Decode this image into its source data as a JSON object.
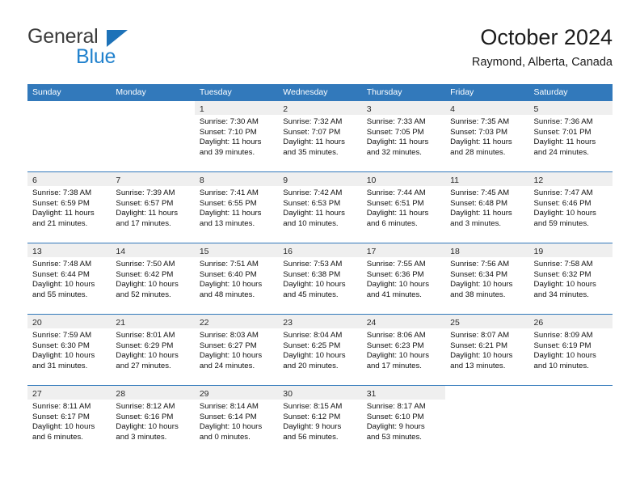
{
  "brand": {
    "name_top": "General",
    "name_bottom": "Blue",
    "triangle_color": "#1d72b8",
    "blue_color": "#2081cd"
  },
  "header": {
    "title": "October 2024",
    "subtitle": "Raymond, Alberta, Canada"
  },
  "theme": {
    "header_bg": "#3279bb",
    "daybar_bg": "#efefef",
    "row_divider": "#3279bb",
    "page_bg": "#ffffff"
  },
  "weekdays": [
    "Sunday",
    "Monday",
    "Tuesday",
    "Wednesday",
    "Thursday",
    "Friday",
    "Saturday"
  ],
  "weeks": [
    [
      {
        "day": "",
        "lines": []
      },
      {
        "day": "",
        "lines": []
      },
      {
        "day": "1",
        "lines": [
          "Sunrise: 7:30 AM",
          "Sunset: 7:10 PM",
          "Daylight: 11 hours",
          "and 39 minutes."
        ]
      },
      {
        "day": "2",
        "lines": [
          "Sunrise: 7:32 AM",
          "Sunset: 7:07 PM",
          "Daylight: 11 hours",
          "and 35 minutes."
        ]
      },
      {
        "day": "3",
        "lines": [
          "Sunrise: 7:33 AM",
          "Sunset: 7:05 PM",
          "Daylight: 11 hours",
          "and 32 minutes."
        ]
      },
      {
        "day": "4",
        "lines": [
          "Sunrise: 7:35 AM",
          "Sunset: 7:03 PM",
          "Daylight: 11 hours",
          "and 28 minutes."
        ]
      },
      {
        "day": "5",
        "lines": [
          "Sunrise: 7:36 AM",
          "Sunset: 7:01 PM",
          "Daylight: 11 hours",
          "and 24 minutes."
        ]
      }
    ],
    [
      {
        "day": "6",
        "lines": [
          "Sunrise: 7:38 AM",
          "Sunset: 6:59 PM",
          "Daylight: 11 hours",
          "and 21 minutes."
        ]
      },
      {
        "day": "7",
        "lines": [
          "Sunrise: 7:39 AM",
          "Sunset: 6:57 PM",
          "Daylight: 11 hours",
          "and 17 minutes."
        ]
      },
      {
        "day": "8",
        "lines": [
          "Sunrise: 7:41 AM",
          "Sunset: 6:55 PM",
          "Daylight: 11 hours",
          "and 13 minutes."
        ]
      },
      {
        "day": "9",
        "lines": [
          "Sunrise: 7:42 AM",
          "Sunset: 6:53 PM",
          "Daylight: 11 hours",
          "and 10 minutes."
        ]
      },
      {
        "day": "10",
        "lines": [
          "Sunrise: 7:44 AM",
          "Sunset: 6:51 PM",
          "Daylight: 11 hours",
          "and 6 minutes."
        ]
      },
      {
        "day": "11",
        "lines": [
          "Sunrise: 7:45 AM",
          "Sunset: 6:48 PM",
          "Daylight: 11 hours",
          "and 3 minutes."
        ]
      },
      {
        "day": "12",
        "lines": [
          "Sunrise: 7:47 AM",
          "Sunset: 6:46 PM",
          "Daylight: 10 hours",
          "and 59 minutes."
        ]
      }
    ],
    [
      {
        "day": "13",
        "lines": [
          "Sunrise: 7:48 AM",
          "Sunset: 6:44 PM",
          "Daylight: 10 hours",
          "and 55 minutes."
        ]
      },
      {
        "day": "14",
        "lines": [
          "Sunrise: 7:50 AM",
          "Sunset: 6:42 PM",
          "Daylight: 10 hours",
          "and 52 minutes."
        ]
      },
      {
        "day": "15",
        "lines": [
          "Sunrise: 7:51 AM",
          "Sunset: 6:40 PM",
          "Daylight: 10 hours",
          "and 48 minutes."
        ]
      },
      {
        "day": "16",
        "lines": [
          "Sunrise: 7:53 AM",
          "Sunset: 6:38 PM",
          "Daylight: 10 hours",
          "and 45 minutes."
        ]
      },
      {
        "day": "17",
        "lines": [
          "Sunrise: 7:55 AM",
          "Sunset: 6:36 PM",
          "Daylight: 10 hours",
          "and 41 minutes."
        ]
      },
      {
        "day": "18",
        "lines": [
          "Sunrise: 7:56 AM",
          "Sunset: 6:34 PM",
          "Daylight: 10 hours",
          "and 38 minutes."
        ]
      },
      {
        "day": "19",
        "lines": [
          "Sunrise: 7:58 AM",
          "Sunset: 6:32 PM",
          "Daylight: 10 hours",
          "and 34 minutes."
        ]
      }
    ],
    [
      {
        "day": "20",
        "lines": [
          "Sunrise: 7:59 AM",
          "Sunset: 6:30 PM",
          "Daylight: 10 hours",
          "and 31 minutes."
        ]
      },
      {
        "day": "21",
        "lines": [
          "Sunrise: 8:01 AM",
          "Sunset: 6:29 PM",
          "Daylight: 10 hours",
          "and 27 minutes."
        ]
      },
      {
        "day": "22",
        "lines": [
          "Sunrise: 8:03 AM",
          "Sunset: 6:27 PM",
          "Daylight: 10 hours",
          "and 24 minutes."
        ]
      },
      {
        "day": "23",
        "lines": [
          "Sunrise: 8:04 AM",
          "Sunset: 6:25 PM",
          "Daylight: 10 hours",
          "and 20 minutes."
        ]
      },
      {
        "day": "24",
        "lines": [
          "Sunrise: 8:06 AM",
          "Sunset: 6:23 PM",
          "Daylight: 10 hours",
          "and 17 minutes."
        ]
      },
      {
        "day": "25",
        "lines": [
          "Sunrise: 8:07 AM",
          "Sunset: 6:21 PM",
          "Daylight: 10 hours",
          "and 13 minutes."
        ]
      },
      {
        "day": "26",
        "lines": [
          "Sunrise: 8:09 AM",
          "Sunset: 6:19 PM",
          "Daylight: 10 hours",
          "and 10 minutes."
        ]
      }
    ],
    [
      {
        "day": "27",
        "lines": [
          "Sunrise: 8:11 AM",
          "Sunset: 6:17 PM",
          "Daylight: 10 hours",
          "and 6 minutes."
        ]
      },
      {
        "day": "28",
        "lines": [
          "Sunrise: 8:12 AM",
          "Sunset: 6:16 PM",
          "Daylight: 10 hours",
          "and 3 minutes."
        ]
      },
      {
        "day": "29",
        "lines": [
          "Sunrise: 8:14 AM",
          "Sunset: 6:14 PM",
          "Daylight: 10 hours",
          "and 0 minutes."
        ]
      },
      {
        "day": "30",
        "lines": [
          "Sunrise: 8:15 AM",
          "Sunset: 6:12 PM",
          "Daylight: 9 hours",
          "and 56 minutes."
        ]
      },
      {
        "day": "31",
        "lines": [
          "Sunrise: 8:17 AM",
          "Sunset: 6:10 PM",
          "Daylight: 9 hours",
          "and 53 minutes."
        ]
      },
      {
        "day": "",
        "lines": []
      },
      {
        "day": "",
        "lines": []
      }
    ]
  ]
}
